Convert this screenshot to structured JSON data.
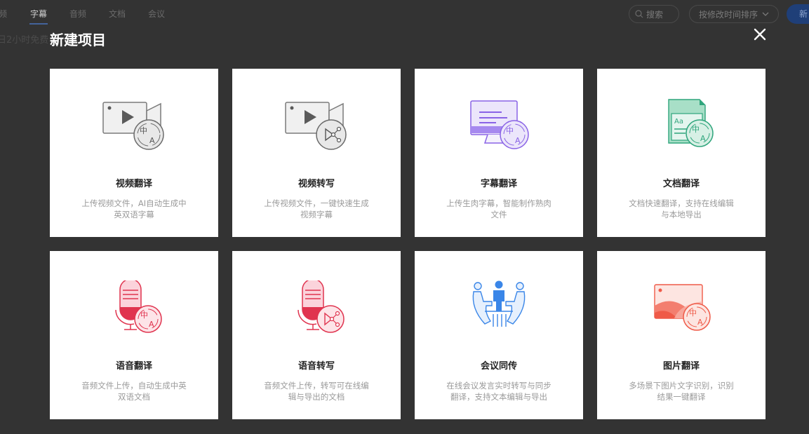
{
  "background": {
    "tabs": [
      {
        "label": "频",
        "active": false
      },
      {
        "label": "字幕",
        "active": true
      },
      {
        "label": "音频",
        "active": false
      },
      {
        "label": "文档",
        "active": false
      },
      {
        "label": "会议",
        "active": false
      }
    ],
    "free_notice": "日2小时免费",
    "search_label": "搜索",
    "sort_label": "按修改时间排序",
    "new_button_label": "新"
  },
  "modal": {
    "title": "新建项目",
    "close_icon": "close-icon",
    "cards": [
      {
        "title": "视频翻译",
        "desc": "上传视频文件，AI自动生成中英双语字幕",
        "icon": "video-translate-icon",
        "accent": "#6b6b6b"
      },
      {
        "title": "视频转写",
        "desc": "上传视频文件，一键快速生成视频字幕",
        "icon": "video-transcribe-icon",
        "accent": "#6b6b6b"
      },
      {
        "title": "字幕翻译",
        "desc": "上传生肉字幕，智能制作熟肉文件",
        "icon": "subtitle-translate-icon",
        "accent": "#8a63e6"
      },
      {
        "title": "文档翻译",
        "desc": "文档快速翻译，支持在线编辑与本地导出",
        "icon": "document-translate-icon",
        "accent": "#2fa57c"
      },
      {
        "title": "语音翻译",
        "desc": "音频文件上传，自动生成中英双语文档",
        "icon": "audio-translate-icon",
        "accent": "#e0344f"
      },
      {
        "title": "语音转写",
        "desc": "音频文件上传，转写可在线编辑与导出的文档",
        "icon": "audio-transcribe-icon",
        "accent": "#e0344f"
      },
      {
        "title": "会议同传",
        "desc": "在线会议发言实时转写与同步翻译，支持文本编辑与导出",
        "icon": "meeting-interpret-icon",
        "accent": "#3a86e8"
      },
      {
        "title": "图片翻译",
        "desc": "多场景下图片文字识别，识别结果一键翻译",
        "icon": "image-translate-icon",
        "accent": "#ef5a48"
      }
    ]
  }
}
